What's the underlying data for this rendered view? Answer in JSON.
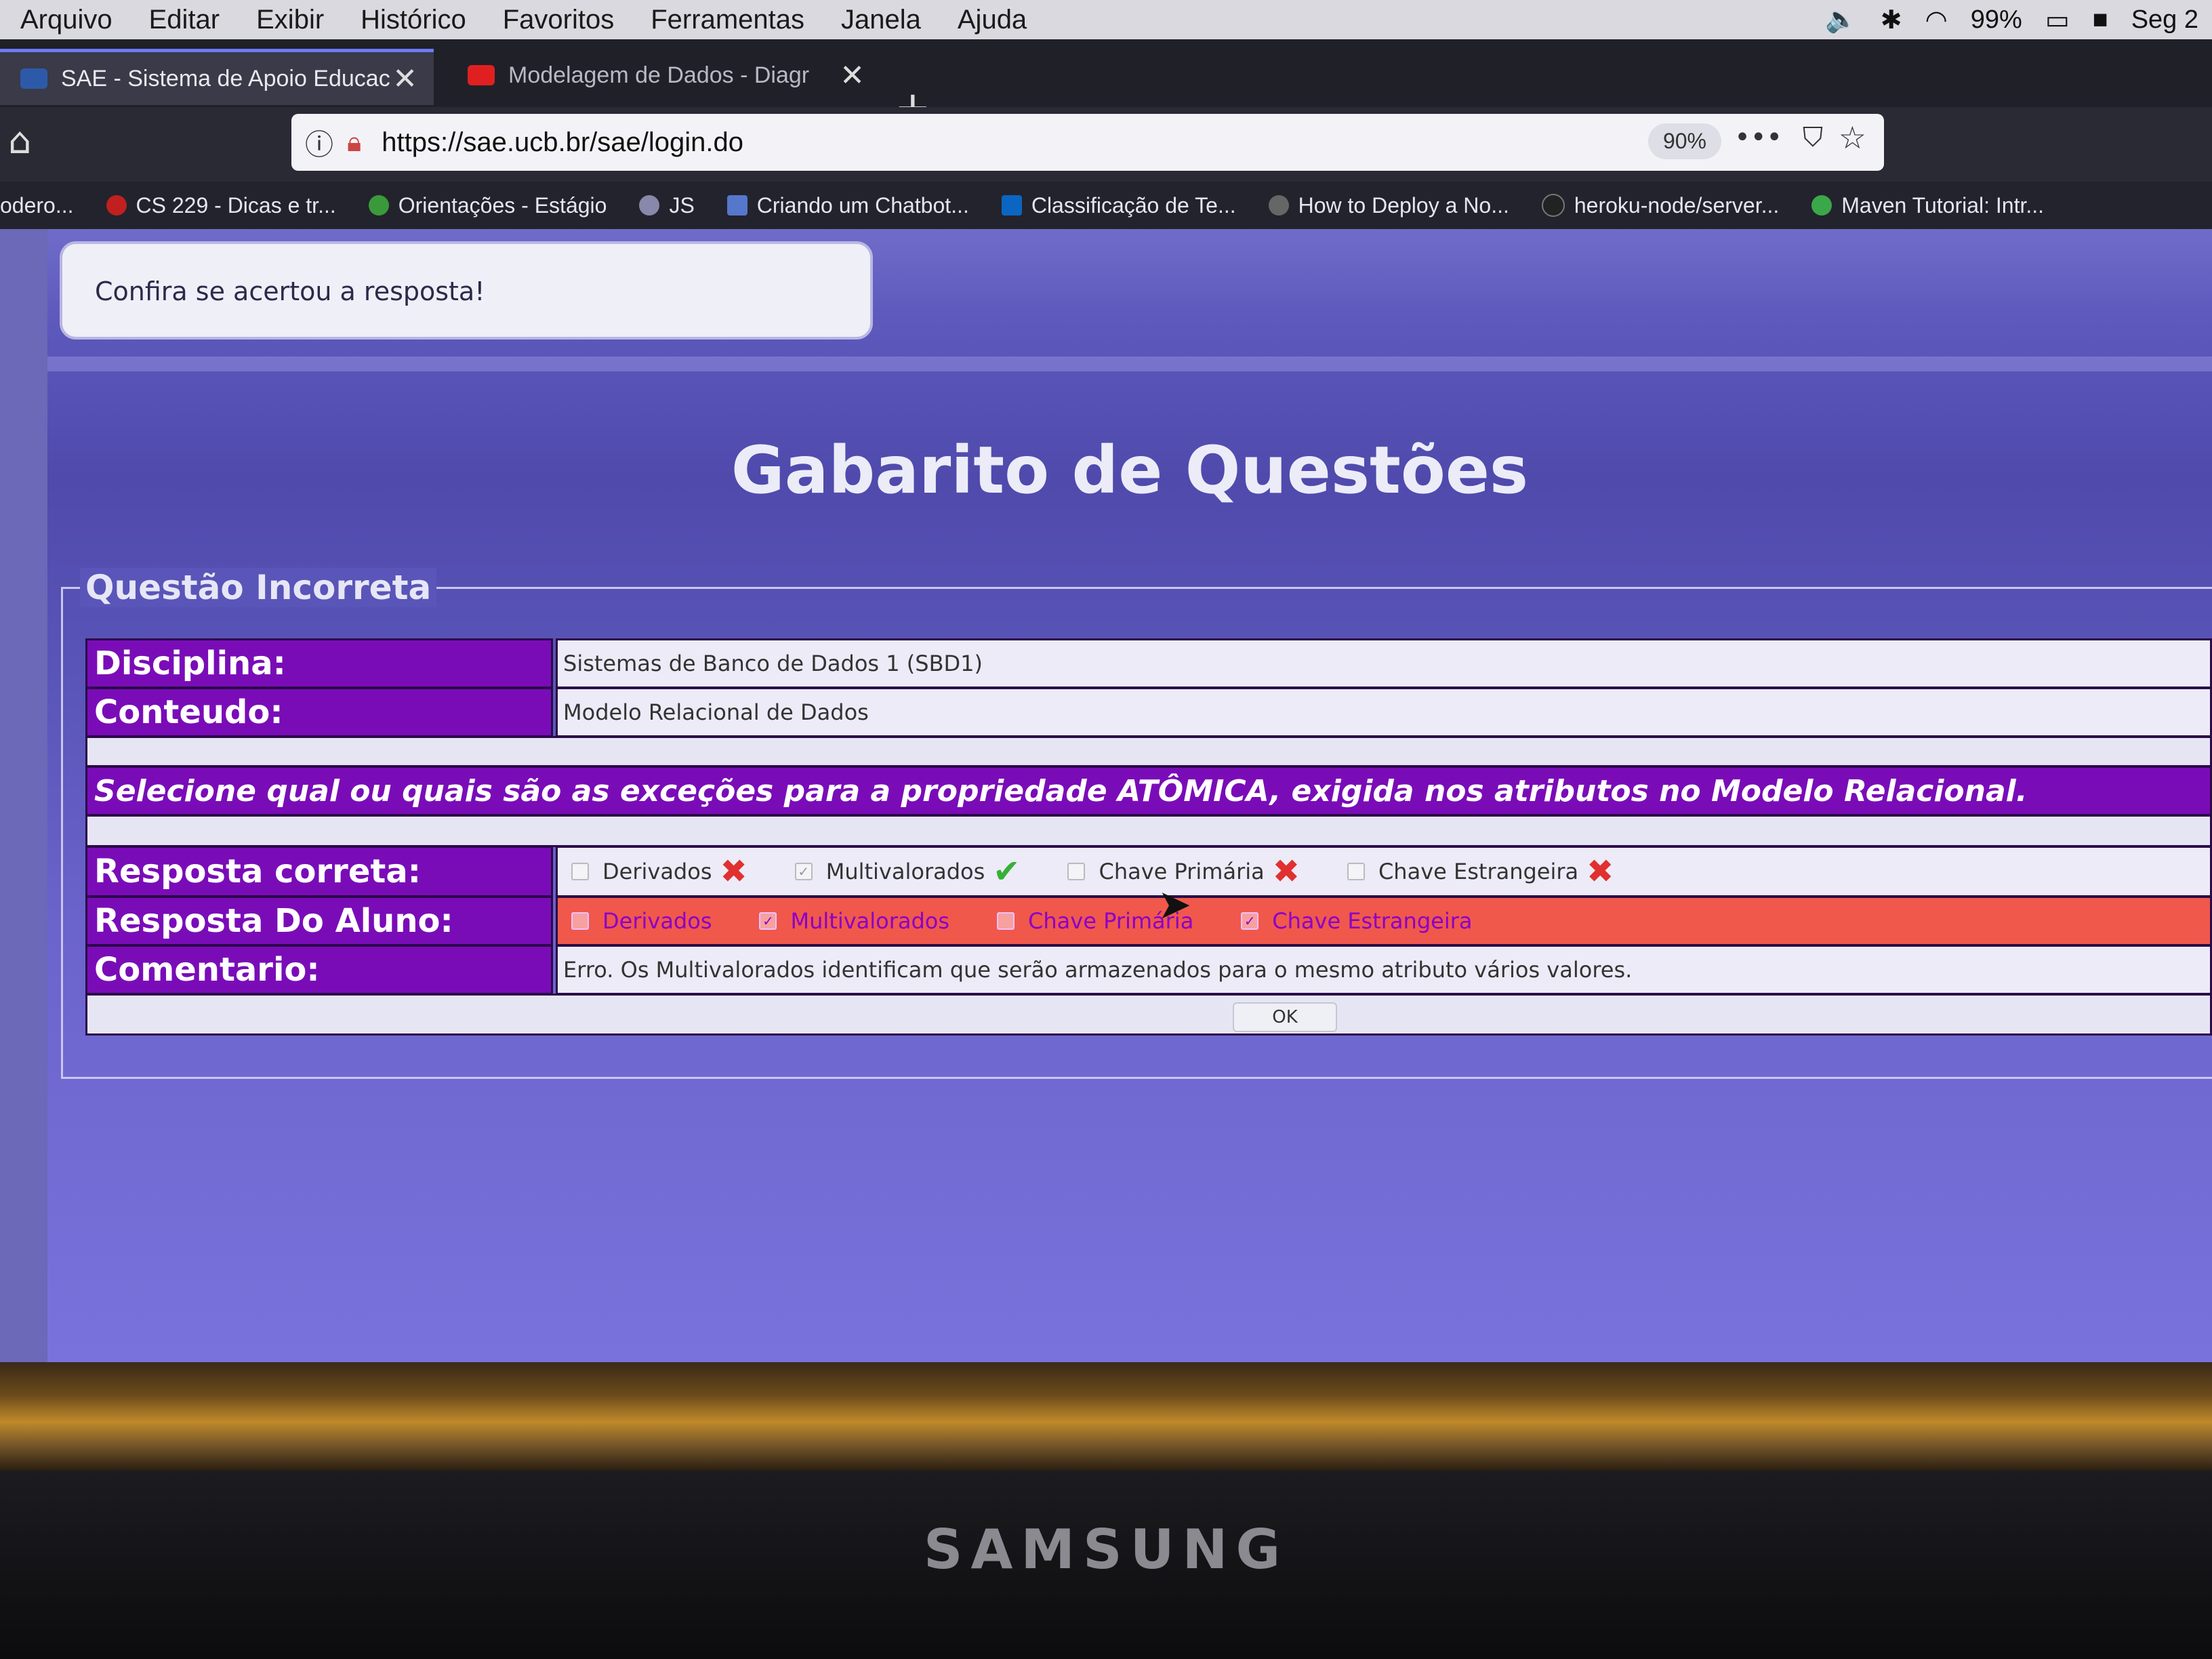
{
  "menubar": {
    "items": [
      "Arquivo",
      "Editar",
      "Exibir",
      "Histórico",
      "Favoritos",
      "Ferramentas",
      "Janela",
      "Ajuda"
    ],
    "battery": "99%",
    "clock": "Seg 2"
  },
  "tabs": [
    {
      "label": "SAE - Sistema de Apoio Educac",
      "favicon_color": "#2d5aa8",
      "active": true
    },
    {
      "label": "Modelagem de Dados - Diagr",
      "favicon_color": "#e02020",
      "active": false
    }
  ],
  "navbar": {
    "url": "https://sae.ucb.br/sae/login.do",
    "zoom": "90%"
  },
  "bookmarks": [
    {
      "label": "odero...",
      "color": "#444"
    },
    {
      "label": "CS 229 - Dicas e tr...",
      "color": "#c02020"
    },
    {
      "label": "Orientações - Estágio",
      "color": "#3a9a3a"
    },
    {
      "label": "JS",
      "color": "#8888aa"
    },
    {
      "label": "Criando um Chatbot...",
      "color": "#5577cc"
    },
    {
      "label": "Classificação de Te...",
      "color": "#0a66c2"
    },
    {
      "label": "How to Deploy a No...",
      "color": "#666"
    },
    {
      "label": "heroku-node/server...",
      "color": "#222"
    },
    {
      "label": "Maven Tutorial: Intr...",
      "color": "#3aa84a"
    }
  ],
  "page": {
    "notice": "Confira se acertou a resposta!",
    "title": "Gabarito de Questões",
    "legend": "Questão Incorreta",
    "disciplina_label": "Disciplina:",
    "disciplina_value": "Sistemas de Banco de Dados 1 (SBD1)",
    "conteudo_label": "Conteudo:",
    "conteudo_value": "Modelo Relacional de Dados",
    "question": "Selecione qual ou quais são as exceções para a propriedade ATÔMICA, exigida nos atributos no Modelo Relacional.",
    "correct_label": "Resposta correta:",
    "correct_options": [
      {
        "label": "Derivados",
        "checked": false,
        "mark": "x"
      },
      {
        "label": "Multivalorados",
        "checked": true,
        "mark": "check"
      },
      {
        "label": "Chave Primária",
        "checked": false,
        "mark": "x"
      },
      {
        "label": "Chave Estrangeira",
        "checked": false,
        "mark": "x"
      }
    ],
    "student_label": "Resposta Do Aluno:",
    "student_options": [
      {
        "label": "Derivados",
        "checked": false
      },
      {
        "label": "Multivalorados",
        "checked": true
      },
      {
        "label": "Chave Primária",
        "checked": false
      },
      {
        "label": "Chave Estrangeira",
        "checked": true
      }
    ],
    "comment_label": "Comentario:",
    "comment_value": "Erro. Os Multivalorados identificam que serão armazenados para o mesmo atributo vários valores.",
    "ok_button": "OK"
  },
  "monitor": {
    "brand": "SAMSUNG"
  }
}
